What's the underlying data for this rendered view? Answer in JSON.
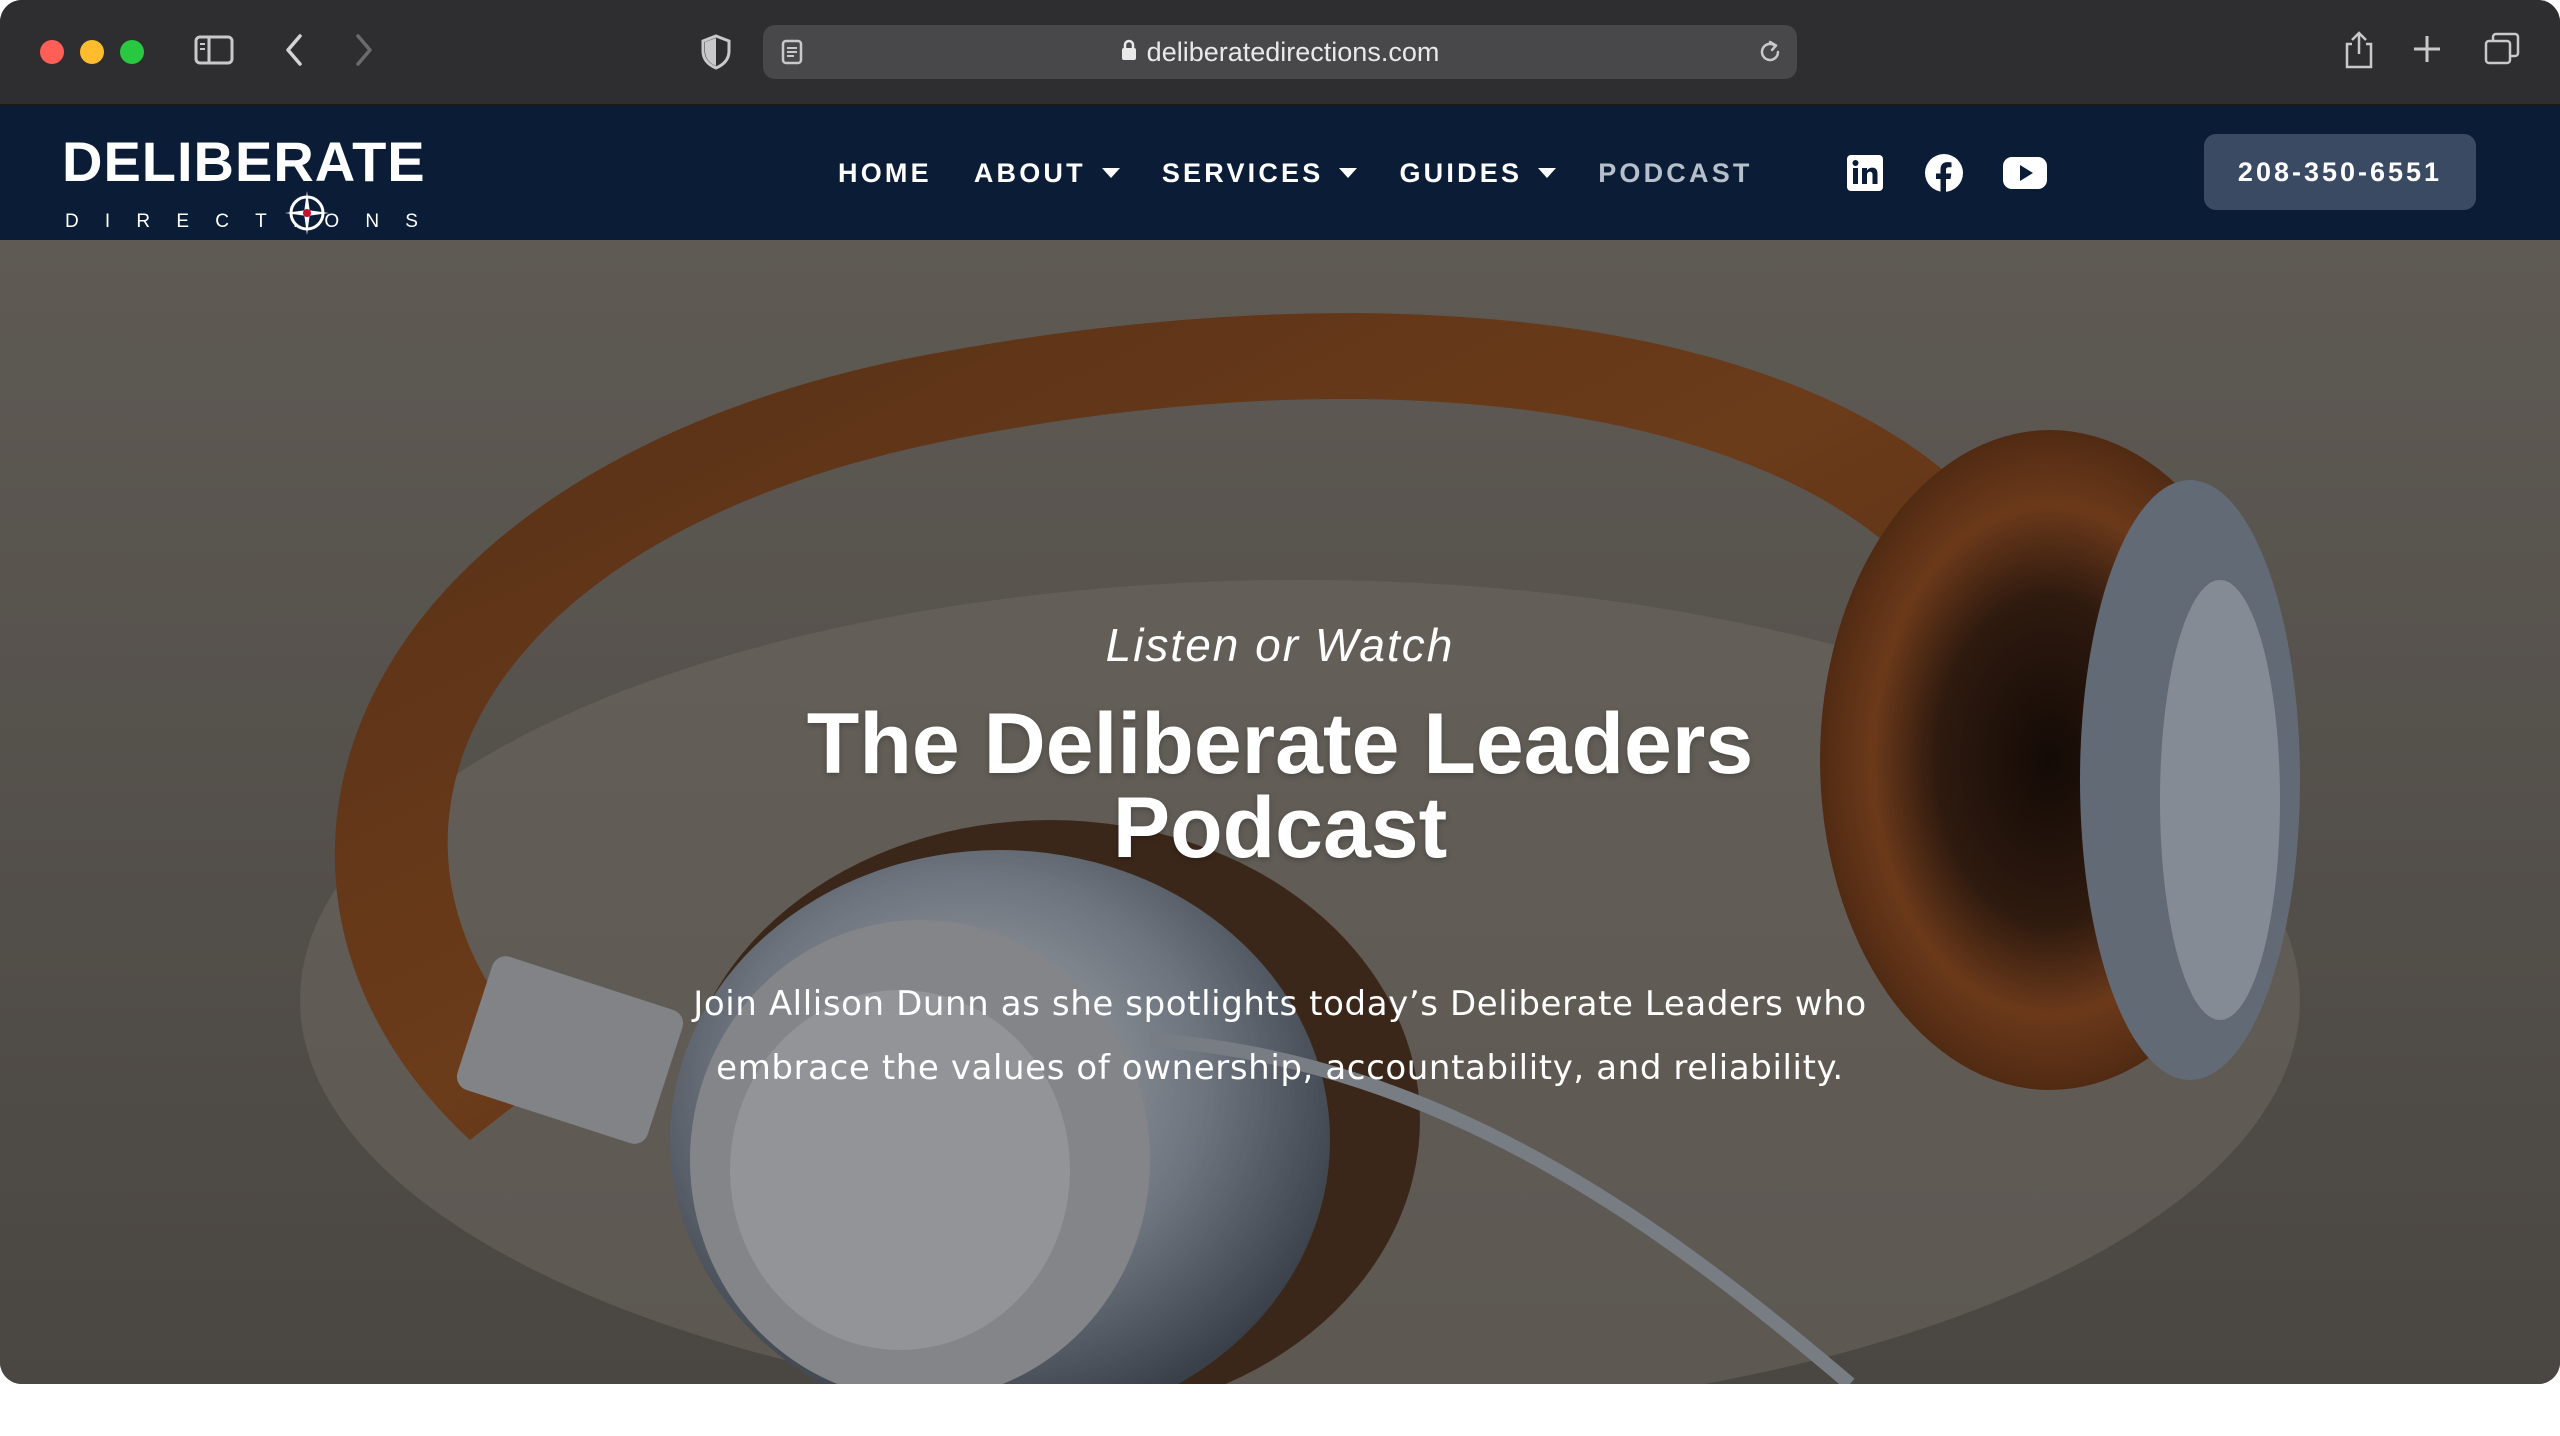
{
  "browser": {
    "url": "deliberatedirections.com"
  },
  "site": {
    "logo": {
      "word": "DELIBERATE",
      "sub": "DIRECTIONS"
    },
    "nav": [
      {
        "label": "HOME",
        "dropdown": false
      },
      {
        "label": "ABOUT",
        "dropdown": true
      },
      {
        "label": "SERVICES",
        "dropdown": true
      },
      {
        "label": "GUIDES",
        "dropdown": true
      },
      {
        "label": "PODCAST",
        "dropdown": false,
        "current": true
      }
    ],
    "social": [
      "linkedin-icon",
      "facebook-icon",
      "youtube-icon"
    ],
    "phone": "208-350-6551"
  },
  "hero": {
    "eyebrow": "Listen or Watch",
    "title": "The Deliberate Leaders Podcast",
    "description": "Join Allison Dunn as she spotlights today’s Deliberate Leaders who embrace the values of ownership, accountability, and reliability."
  },
  "colors": {
    "header_bg": "#0b1c37",
    "phone_button_bg": "#3a4a63",
    "nav_current": "#b7bfcb"
  }
}
